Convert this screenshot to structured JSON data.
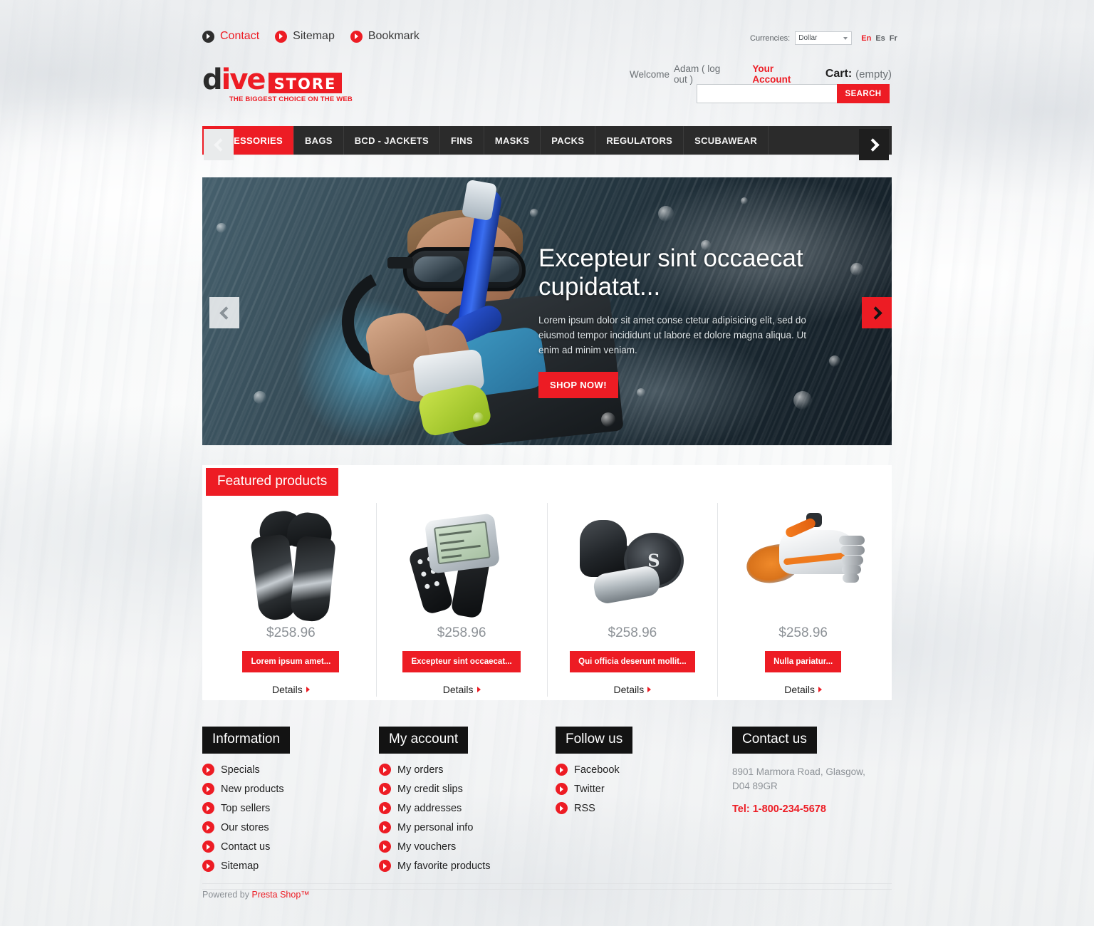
{
  "topbar": {
    "links": [
      {
        "label": "Contact",
        "icon": "arrow-bullet-dark",
        "accent": true
      },
      {
        "label": "Sitemap",
        "icon": "arrow-bullet-red",
        "accent": false
      },
      {
        "label": "Bookmark",
        "icon": "arrow-bullet-red",
        "accent": false
      }
    ],
    "currencies_label": "Currencies:",
    "currency_selected": "Dollar",
    "languages": [
      {
        "code": "En",
        "active": true
      },
      {
        "code": "Es",
        "active": false
      },
      {
        "code": "Fr",
        "active": false
      }
    ]
  },
  "logo": {
    "part1": "d",
    "part2": "ive",
    "badge": "STORE",
    "tagline": "THE BIGGEST CHOICE ON THE WEB"
  },
  "account": {
    "welcome": "Welcome",
    "user": "Adam ( log out )",
    "your_account": "Your Account",
    "cart_label": "Cart:",
    "cart_value": "(empty)"
  },
  "search": {
    "value": "",
    "placeholder": "",
    "button": "SEARCH"
  },
  "nav": {
    "items": [
      {
        "label": "ACCESSORIES",
        "active": true
      },
      {
        "label": "BAGS",
        "active": false
      },
      {
        "label": "BCD - JACKETS",
        "active": false
      },
      {
        "label": "FINS",
        "active": false
      },
      {
        "label": "MASKS",
        "active": false
      },
      {
        "label": "PACKS",
        "active": false
      },
      {
        "label": "REGULATORS",
        "active": false
      },
      {
        "label": "SCUBAWEAR",
        "active": false
      }
    ]
  },
  "hero": {
    "title": "Excepteur sint occaecat cupidatat...",
    "description": "Lorem ipsum dolor sit amet conse ctetur adipisicing elit, sed do eiusmod tempor incididunt ut labore et dolore magna aliqua. Ut enim ad minim veniam.",
    "button": "SHOP NOW!",
    "prev_icon": "chevron-left-icon",
    "next_icon": "chevron-right-icon"
  },
  "featured": {
    "title": "Featured products",
    "prev_icon": "chevron-left-icon",
    "next_icon": "chevron-right-icon",
    "details_label": "Details",
    "products": [
      {
        "image": "diving-fins",
        "price": "$258.96",
        "name": "Lorem ipsum amet...",
        "details": "Details"
      },
      {
        "image": "dive-computer-watch",
        "price": "$258.96",
        "name": "Excepteur sint occaecat...",
        "details": "Details"
      },
      {
        "image": "scuba-regulator",
        "price": "$258.96",
        "name": "Qui officia deserunt mollit...",
        "details": "Details"
      },
      {
        "image": "water-shoes",
        "price": "$258.96",
        "name": "Nulla pariatur...",
        "details": "Details"
      }
    ]
  },
  "footer": {
    "columns": [
      {
        "heading": "Information",
        "items": [
          "Specials",
          "New products",
          "Top sellers",
          "Our stores",
          "Contact us",
          "Sitemap"
        ]
      },
      {
        "heading": "My account",
        "items": [
          "My orders",
          "My credit slips",
          "My addresses",
          "My personal info",
          "My vouchers",
          "My favorite products"
        ]
      },
      {
        "heading": "Follow us",
        "items": [
          "Facebook",
          "Twitter",
          "RSS"
        ]
      }
    ],
    "contact": {
      "heading": "Contact us",
      "address_line1": "8901 Marmora Road, Glasgow,",
      "address_line2": "D04 89GR",
      "tel": "Tel: 1-800-234-5678"
    },
    "powered_prefix": "Powered by ",
    "powered_brand": "Presta Shop™"
  },
  "colors": {
    "accent": "#ed1c24",
    "dark": "#2b2b2b",
    "footer_head": "#131313"
  }
}
